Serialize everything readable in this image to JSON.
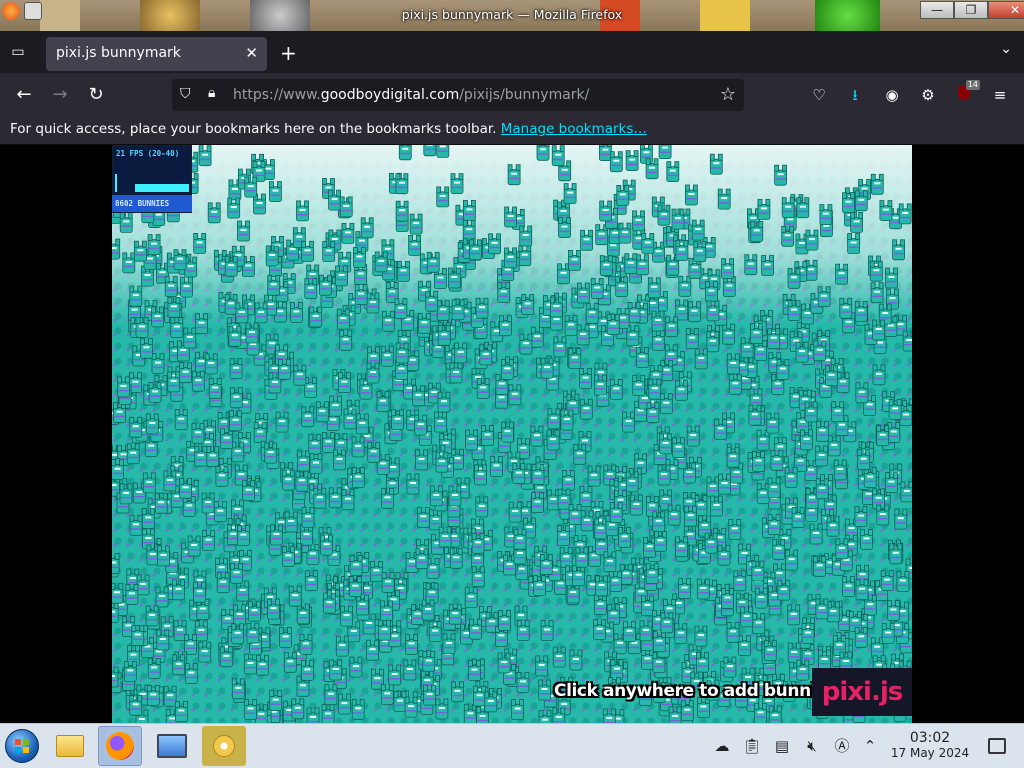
{
  "window": {
    "title": "pixi.js bunnymark — Mozilla Firefox",
    "controls": {
      "minimize": "—",
      "maximize": "❐",
      "close": "✕"
    }
  },
  "tabs": [
    {
      "label": "pixi.js bunnymark",
      "close": "✕",
      "active": true
    }
  ],
  "tabstrip": {
    "new_tab": "+",
    "list_all": "⌄",
    "overview_icon": "tab-overview-icon"
  },
  "nav": {
    "back": "←",
    "forward": "→",
    "reload": "↻",
    "url_prefix": "https://www.",
    "url_host": "goodboydigital.com",
    "url_path": "/pixijs/bunnymark/",
    "star": "☆"
  },
  "toolbar": {
    "pocket": "♡",
    "downloads": "⭳",
    "account": "◉",
    "extensions": "⚙",
    "extension_badge": "14",
    "menu": "≡"
  },
  "bookmarks_bar": {
    "message": "For quick access, place your bookmarks here on the bookmarks toolbar.",
    "link": "Manage bookmarks…"
  },
  "page": {
    "fps_text": "21 FPS (20-40)",
    "bunny_count": "8602 BUNNIES",
    "click_message": "Click anywhere to add bunnies!",
    "logo_text": "pixi.js"
  },
  "taskbar": {
    "apps": [
      "file-manager",
      "firefox",
      "system-monitor",
      "disc-burner"
    ],
    "clock": {
      "time": "03:02",
      "date": "17 May 2024"
    }
  },
  "colors": {
    "bunny": "#26b9aa",
    "tab_active": "#42414d",
    "accent_link": "#00ddff"
  }
}
